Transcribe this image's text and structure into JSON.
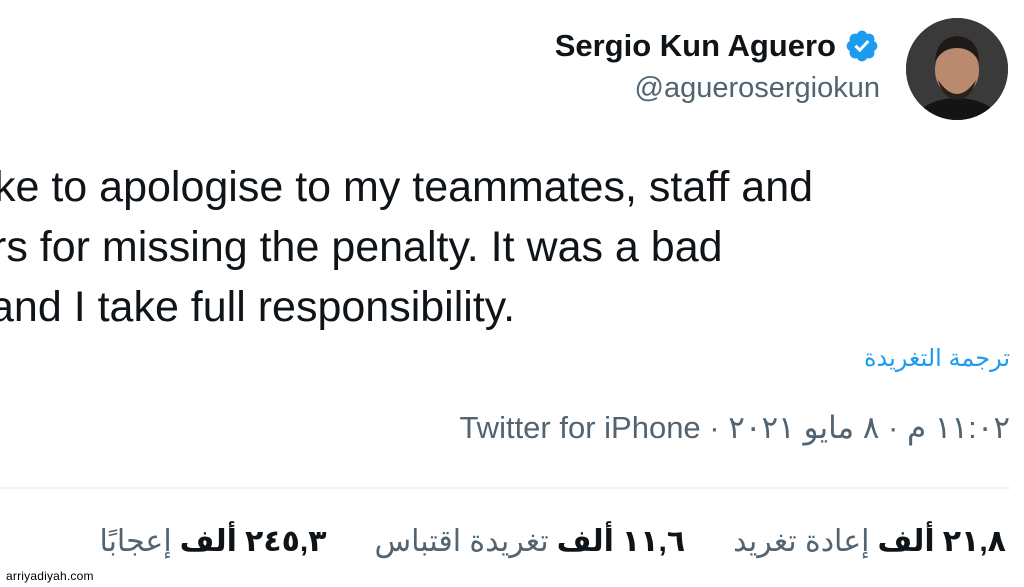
{
  "author": {
    "name": "Sergio Kun Aguero",
    "handle": "@aguerosergiokun",
    "verified_color": "#1d9bf0"
  },
  "tweet": {
    "line1": "ke to apologise to my teammates, staff and",
    "line2": "rs for missing the penalty. It was a bad",
    "line3": "and I take full responsibility."
  },
  "translate_label": "ترجمة التغريدة",
  "meta": "١١:٠٢ م · ٨ مايو ٢٠٢١ · Twitter for iPhone",
  "stats": {
    "retweets": {
      "value": "٢١,٨",
      "unit": "ألف",
      "label": "إعادة تغريد"
    },
    "quotes": {
      "value": "١١,٦",
      "unit": "ألف",
      "label": "تغريدة اقتباس"
    },
    "likes": {
      "value": "٢٤٥,٣",
      "unit": "ألف",
      "label": "إعجابًا"
    }
  },
  "watermark": "arriyadiyah.com"
}
